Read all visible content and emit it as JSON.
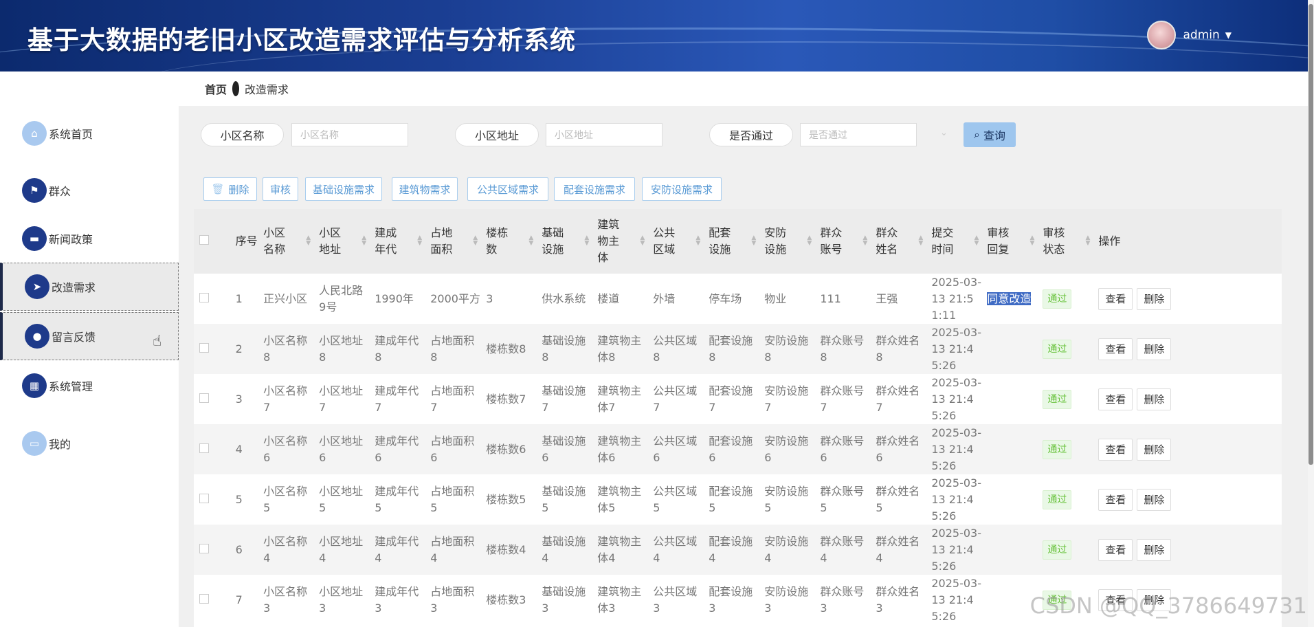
{
  "header": {
    "title": "基于大数据的老旧小区改造需求评估与分析系统",
    "user": "admin"
  },
  "sidebar": {
    "items": [
      {
        "label": "系统首页",
        "icon": "home-icon"
      },
      {
        "label": "群众",
        "icon": "flag-icon"
      },
      {
        "label": "新闻政策",
        "icon": "news-icon"
      },
      {
        "label": "改造需求",
        "icon": "send-icon"
      },
      {
        "label": "留言反馈",
        "icon": "bulb-icon"
      },
      {
        "label": "系统管理",
        "icon": "grid-icon"
      },
      {
        "label": "我的",
        "icon": "card-icon"
      }
    ]
  },
  "breadcrumb": {
    "home": "首页",
    "current": "改造需求"
  },
  "search": {
    "name_label": "小区名称",
    "name_placeholder": "小区名称",
    "addr_label": "小区地址",
    "addr_placeholder": "小区地址",
    "pass_label": "是否通过",
    "pass_placeholder": "是否通过",
    "query": "查询"
  },
  "actions": [
    "删除",
    "审核",
    "基础设施需求",
    "建筑物需求",
    "公共区域需求",
    "配套设施需求",
    "安防设施需求"
  ],
  "table": {
    "headers": [
      "序号",
      "小区名称",
      "小区地址",
      "建成年代",
      "占地面积",
      "楼栋数",
      "基础设施",
      "建筑物主体",
      "公共区域",
      "配套设施",
      "安防设施",
      "群众账号",
      "群众姓名",
      "提交时间",
      "审核回复",
      "审核状态",
      "操作"
    ],
    "rows": [
      [
        "1",
        "正兴小区",
        "人民北路9号",
        "1990年",
        "2000平方",
        "3",
        "供水系统",
        "楼道",
        "外墙",
        "停车场",
        "物业",
        "111",
        "王强",
        "2025-03-13 21:51:11",
        "同意改造",
        "通过"
      ],
      [
        "2",
        "小区名称8",
        "小区地址8",
        "建成年代8",
        "占地面积8",
        "楼栋数8",
        "基础设施8",
        "建筑物主体8",
        "公共区域8",
        "配套设施8",
        "安防设施8",
        "群众账号8",
        "群众姓名8",
        "2025-03-13 21:45:26",
        "",
        "通过"
      ],
      [
        "3",
        "小区名称7",
        "小区地址7",
        "建成年代7",
        "占地面积7",
        "楼栋数7",
        "基础设施7",
        "建筑物主体7",
        "公共区域7",
        "配套设施7",
        "安防设施7",
        "群众账号7",
        "群众姓名7",
        "2025-03-13 21:45:26",
        "",
        "通过"
      ],
      [
        "4",
        "小区名称6",
        "小区地址6",
        "建成年代6",
        "占地面积6",
        "楼栋数6",
        "基础设施6",
        "建筑物主体6",
        "公共区域6",
        "配套设施6",
        "安防设施6",
        "群众账号6",
        "群众姓名6",
        "2025-03-13 21:45:26",
        "",
        "通过"
      ],
      [
        "5",
        "小区名称5",
        "小区地址5",
        "建成年代5",
        "占地面积5",
        "楼栋数5",
        "基础设施5",
        "建筑物主体5",
        "公共区域5",
        "配套设施5",
        "安防设施5",
        "群众账号5",
        "群众姓名5",
        "2025-03-13 21:45:26",
        "",
        "通过"
      ],
      [
        "6",
        "小区名称4",
        "小区地址4",
        "建成年代4",
        "占地面积4",
        "楼栋数4",
        "基础设施4",
        "建筑物主体4",
        "公共区域4",
        "配套设施4",
        "安防设施4",
        "群众账号4",
        "群众姓名4",
        "2025-03-13 21:45:26",
        "",
        "通过"
      ],
      [
        "7",
        "小区名称3",
        "小区地址3",
        "建成年代3",
        "占地面积3",
        "楼栋数3",
        "基础设施3",
        "建筑物主体3",
        "公共区域3",
        "配套设施3",
        "安防设施3",
        "群众账号3",
        "群众姓名3",
        "2025-03-13 21:45:26",
        "",
        "通过"
      ]
    ],
    "view_label": "查看",
    "delete_label": "删除"
  },
  "watermark": "CSDN @QQ_3786649731"
}
